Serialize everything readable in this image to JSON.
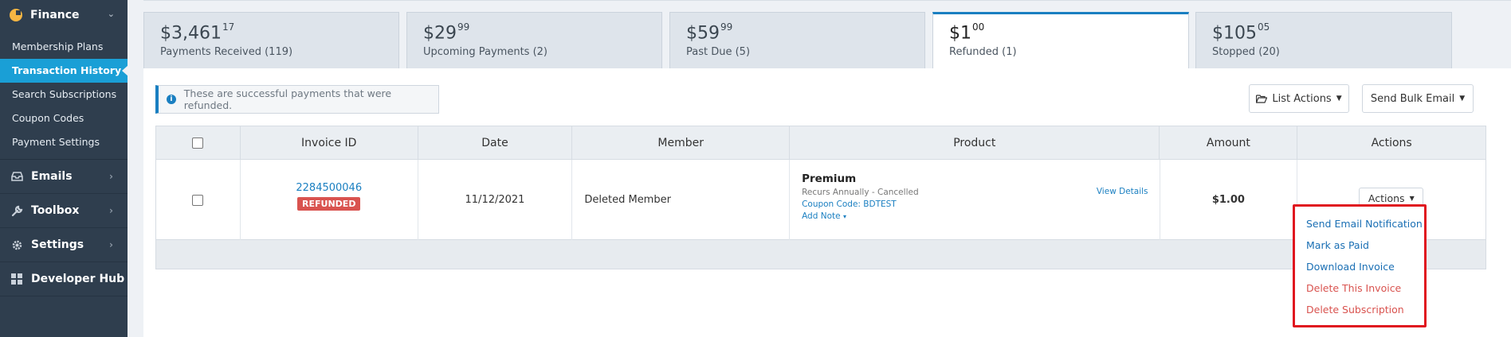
{
  "sidebar": {
    "section": {
      "label": "Finance",
      "icon": "pie-chart-icon",
      "chevron": "⌄"
    },
    "subitems": [
      {
        "label": "Membership Plans",
        "active": false
      },
      {
        "label": "Transaction History",
        "active": true
      },
      {
        "label": "Search Subscriptions",
        "active": false
      },
      {
        "label": "Coupon Codes",
        "active": false
      },
      {
        "label": "Payment Settings",
        "active": false
      }
    ],
    "items": [
      {
        "label": "Emails",
        "icon": "inbox-icon"
      },
      {
        "label": "Toolbox",
        "icon": "wrench-icon"
      },
      {
        "label": "Settings",
        "icon": "gear-icon"
      },
      {
        "label": "Developer Hub",
        "icon": "grid-icon"
      }
    ]
  },
  "tabs": [
    {
      "amount": "$3,461",
      "cents": "17",
      "label": "Payments Received (119)",
      "active": false
    },
    {
      "amount": "$29",
      "cents": "99",
      "label": "Upcoming Payments (2)",
      "active": false
    },
    {
      "amount": "$59",
      "cents": "99",
      "label": "Past Due (5)",
      "active": false
    },
    {
      "amount": "$1",
      "cents": "00",
      "label": "Refunded (1)",
      "active": true
    },
    {
      "amount": "$105",
      "cents": "05",
      "label": "Stopped (20)",
      "active": false
    }
  ],
  "info_message": "These are successful payments that were refunded.",
  "toolbar": {
    "list_actions": "List Actions",
    "send_bulk_email": "Send Bulk Email"
  },
  "table": {
    "headers": [
      "Invoice ID",
      "Date",
      "Member",
      "Product",
      "Amount",
      "Actions"
    ],
    "rows": [
      {
        "invoice_id": "2284500046",
        "status": "REFUNDED",
        "date": "11/12/2021",
        "member": "Deleted Member",
        "product_name": "Premium",
        "product_recurs": "Recurs Annually - Cancelled",
        "coupon": "Coupon Code: BDTEST",
        "add_note": "Add Note",
        "view_details": "View Details",
        "amount": "$1.00",
        "actions_label": "Actions"
      }
    ]
  },
  "actions_menu": [
    {
      "label": "Send Email Notification",
      "kind": "blue"
    },
    {
      "label": "Mark as Paid",
      "kind": "blue"
    },
    {
      "label": "Download Invoice",
      "kind": "blue"
    },
    {
      "label": "Delete This Invoice",
      "kind": "red"
    },
    {
      "label": "Delete Subscription",
      "kind": "red"
    }
  ],
  "colors": {
    "sidebar_bg": "#2f3e4e",
    "active_item": "#1a9fd6",
    "accent": "#1a7fc1",
    "refunded_badge": "#d9534f",
    "menu_highlight": "#e0161f"
  }
}
